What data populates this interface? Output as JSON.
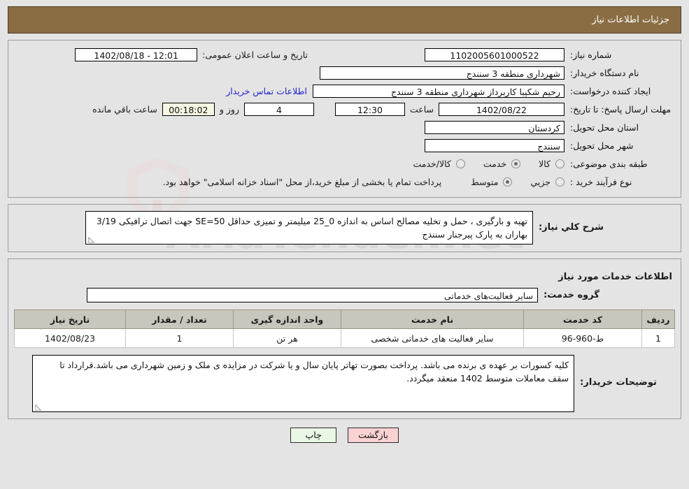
{
  "header": {
    "title": "جزئیات اطلاعات نیاز",
    "bar_color": "#8a6d43"
  },
  "main_form": {
    "need_number": {
      "label": "شماره نیاز:",
      "value": "1102005601000522"
    },
    "public_announce": {
      "label": "تاریخ و ساعت اعلان عمومی:",
      "value": "1402/08/18 - 12:01"
    },
    "buyer_org": {
      "label": "نام دستگاه خریدار:",
      "value": "شهرداری منطقه 3 سنندج"
    },
    "request_creator": {
      "label": "ایجاد کننده درخواست:",
      "value": "رحیم شکیبا کاربرداز شهرداری منطقه 3 سنندج"
    },
    "contact_link": {
      "label": "اطلاعات تماس خریدار",
      "color": "#2222cc"
    },
    "deadline": {
      "label": "مهلت ارسال پاسخ: تا تاریخ:",
      "date": "1402/08/22",
      "hour_label": "ساعت",
      "hour": "12:30",
      "days": "4",
      "days_label": "روز و",
      "countdown": "00:18:02",
      "countdown_label": "ساعت باقي مانده"
    },
    "delivery_province": {
      "label": "استان محل تحویل:",
      "value": "کردستان"
    },
    "delivery_city": {
      "label": "شهر محل تحویل:",
      "value": "سنندج"
    },
    "category": {
      "label": "طبقه بندی موضوعی:",
      "options": [
        {
          "label": "کالا",
          "selected": false
        },
        {
          "label": "خدمت",
          "selected": true
        },
        {
          "label": "کالا/خدمت",
          "selected": false
        }
      ]
    },
    "purchase_type": {
      "label": "نوع فرآیند خرید :",
      "options": [
        {
          "label": "جزیي",
          "selected": false
        },
        {
          "label": "متوسط",
          "selected": true
        }
      ],
      "note": "پرداخت تمام یا بخشی از مبلغ خرید،از محل \"اسناد خزانه اسلامی\" خواهد بود."
    }
  },
  "description": {
    "label": "شرح کلي نیاز:",
    "text": "تهیه و بارگیری ، حمل و تخلیه مصالح اساس به اندازه 0_25 میلیمتر و تمیزی حداقل SE=50 جهت اتصال ترافیکی 3/19 بهاران به پارک پیرجنار سنندج"
  },
  "services_section": {
    "title": "اطلاعات خدمات مورد نیاز",
    "service_group": {
      "label": "گروه خدمت:",
      "value": "سایر فعالیت‌های خدماتی"
    },
    "table": {
      "columns": [
        "ردیف",
        "کد خدمت",
        "نام خدمت",
        "واحد اندازه گیری",
        "تعداد / مقدار",
        "تاریخ نیاز"
      ],
      "rows": [
        {
          "row_no": "1",
          "service_code": "ط-960-96",
          "service_name": "سایر فعالیت های خدماتی شخصی",
          "unit": "هر تن",
          "quantity": "1",
          "need_date": "1402/08/23"
        }
      ]
    }
  },
  "buyer_notes": {
    "label": "توضیحات خریدار:",
    "text": "کلیه کسورات بر عهده ی برنده می باشد. پرداخت بصورت تهاتر پایان سال و یا شرکت در مزایده ی ملک و زمین شهرداری می باشد.قرارداد تا سقف معاملات متوسط 1402 منعقد میگردد."
  },
  "footer": {
    "back_button": "بازگشت",
    "print_button": "چاپ"
  },
  "watermark": {
    "text": "AriaTender.net"
  }
}
